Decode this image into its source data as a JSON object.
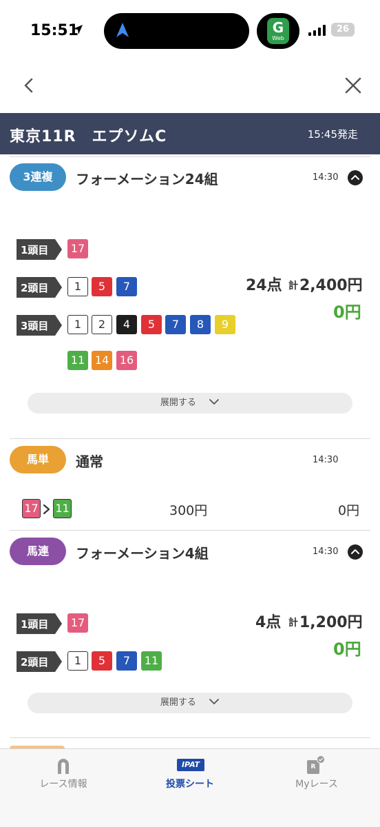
{
  "status": {
    "time": "15:51",
    "battery": "26"
  },
  "race": {
    "title": "東京11R　エプソムC",
    "start_time": "15:45発走"
  },
  "ticket1": {
    "type": "3連複",
    "type_color": "#3e8fc5",
    "method": "フォーメーション24組",
    "time": "14:30",
    "rows": [
      {
        "label": "1頭目",
        "numbers": [
          "17"
        ]
      },
      {
        "label": "2頭目",
        "numbers": [
          "1",
          "5",
          "7"
        ]
      },
      {
        "label": "3頭目",
        "numbers": [
          "1",
          "2",
          "4",
          "5",
          "7",
          "8",
          "9",
          "11",
          "14",
          "16"
        ]
      }
    ],
    "points": "24点",
    "total_prefix": "計",
    "total": "2,400円",
    "payout": "0円",
    "expand_label": "展開する"
  },
  "ticket2": {
    "type": "馬単",
    "type_color": "#e8a132",
    "method": "通常",
    "time": "14:30",
    "first": "17",
    "second": "11",
    "amount": "300円",
    "payout": "0円"
  },
  "ticket3": {
    "type": "馬連",
    "type_color": "#8b4fa6",
    "method": "フォーメーション4組",
    "time": "14:30",
    "rows": [
      {
        "label": "1頭目",
        "numbers": [
          "17"
        ]
      },
      {
        "label": "2頭目",
        "numbers": [
          "1",
          "5",
          "7",
          "11"
        ]
      }
    ],
    "points": "4点",
    "total_prefix": "計",
    "total": "1,200円",
    "payout": "0円",
    "expand_label": "展開する"
  },
  "tabs": [
    {
      "label": "レース情報",
      "icon": "horseshoe-icon"
    },
    {
      "label": "投票シート",
      "icon": "ipat-icon",
      "badge": "IPAT"
    },
    {
      "label": "Myレース",
      "icon": "my-race-icon",
      "badge": "R"
    }
  ]
}
